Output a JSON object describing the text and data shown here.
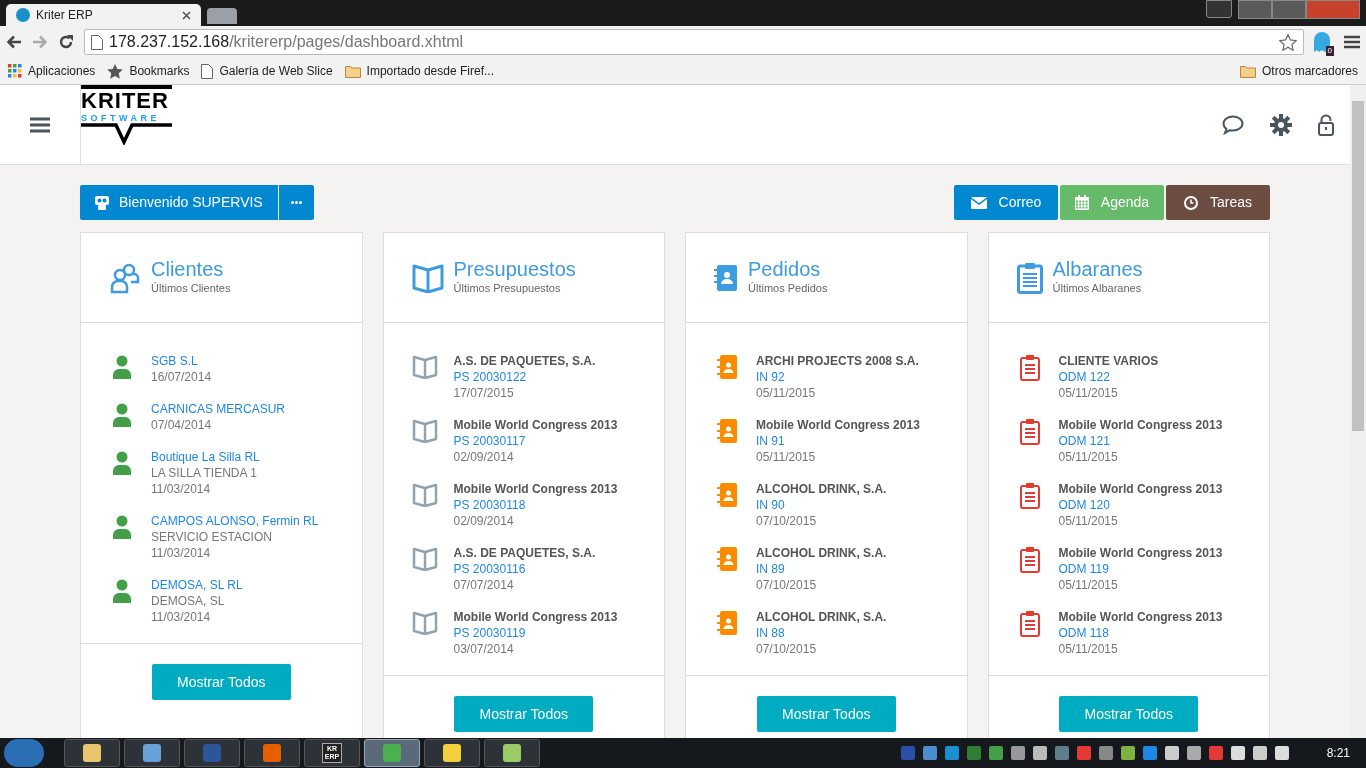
{
  "browser": {
    "tabs": [
      {
        "title": "Kriter ERP",
        "selected": true
      },
      {
        "selected": false
      }
    ],
    "url_host": "178.237.152.168",
    "url_path": "/kritererp/pages/dashboard.xhtml",
    "extension_badge": "0",
    "bookmarks": [
      {
        "kind": "apps",
        "label": "Aplicaciones"
      },
      {
        "kind": "star",
        "label": "Bookmarks"
      },
      {
        "kind": "page",
        "label": "Galería de Web Slice"
      },
      {
        "kind": "folder",
        "label": "Importado desde Firef..."
      }
    ],
    "other_bookmarks": "Otros marcadores"
  },
  "header": {
    "logo_top": "KRITER",
    "logo_bottom": "SOFTWARE"
  },
  "welcome_button": "Bienvenido SUPERVIS",
  "actions": [
    {
      "kind": "mail",
      "label": "Correo",
      "color": "#0288d1"
    },
    {
      "kind": "calendar",
      "label": "Agenda",
      "color": "#66bb6a"
    },
    {
      "kind": "clock",
      "label": "Tareas",
      "color": "#6d4c41"
    }
  ],
  "cards": [
    {
      "kind": "clients",
      "title": "Clientes",
      "subtitle": "Últimos Clientes",
      "button": "Mostrar Todos",
      "items": [
        {
          "name": "SGB S.L",
          "date": "16/07/2014"
        },
        {
          "name": "CARNICAS MERCASUR",
          "date": "07/04/2014"
        },
        {
          "name": "Boutique La Silla RL",
          "detail": "LA SILLA TIENDA 1",
          "date": "11/03/2014"
        },
        {
          "name": "CAMPOS ALONSO, Fermin RL",
          "detail": "SERVICIO ESTACION",
          "date": "11/03/2014"
        },
        {
          "name": "DEMOSA, SL RL",
          "detail": "DEMOSA, SL",
          "date": "11/03/2014"
        }
      ]
    },
    {
      "kind": "quotes",
      "title": "Presupuestos",
      "subtitle": "Últimos Presupuestos",
      "button": "Mostrar Todos",
      "items": [
        {
          "name": "A.S. DE PAQUETES, S.A.",
          "code": "PS 20030122",
          "date": "17/07/2015"
        },
        {
          "name": "Mobile World Congress 2013",
          "code": "PS 20030117",
          "date": "02/09/2014"
        },
        {
          "name": "Mobile World Congress 2013",
          "code": "PS 20030118",
          "date": "02/09/2014"
        },
        {
          "name": "A.S. DE PAQUETES, S.A.",
          "code": "PS 20030116",
          "date": "07/07/2014"
        },
        {
          "name": "Mobile World Congress 2013",
          "code": "PS 20030119",
          "date": "03/07/2014"
        }
      ]
    },
    {
      "kind": "orders",
      "title": "Pedidos",
      "subtitle": "Últimos Pedidos",
      "button": "Mostrar Todos",
      "items": [
        {
          "name": "ARCHI PROJECTS 2008 S.A.",
          "code": "IN 92",
          "date": "05/11/2015"
        },
        {
          "name": "Mobile World Congress 2013",
          "code": "IN 91",
          "date": "05/11/2015"
        },
        {
          "name": "ALCOHOL DRINK, S.A.",
          "code": "IN 90",
          "date": "07/10/2015"
        },
        {
          "name": "ALCOHOL DRINK, S.A.",
          "code": "IN 89",
          "date": "07/10/2015"
        },
        {
          "name": "ALCOHOL DRINK, S.A.",
          "code": "IN 88",
          "date": "07/10/2015"
        }
      ]
    },
    {
      "kind": "delivery",
      "title": "Albaranes",
      "subtitle": "Últimos Albaranes",
      "button": "Mostrar Todos",
      "items": [
        {
          "name": "CLIENTE VARIOS",
          "code": "ODM 122",
          "date": "05/11/2015"
        },
        {
          "name": "Mobile World Congress 2013",
          "code": "ODM 121",
          "date": "05/11/2015"
        },
        {
          "name": "Mobile World Congress 2013",
          "code": "ODM 120",
          "date": "05/11/2015"
        },
        {
          "name": "Mobile World Congress 2013",
          "code": "ODM 119",
          "date": "05/11/2015"
        },
        {
          "name": "Mobile World Congress 2013",
          "code": "ODM 118",
          "date": "05/11/2015"
        }
      ]
    }
  ],
  "taskbar": {
    "apps": [
      {
        "kind": "explorer",
        "selected": false
      },
      {
        "kind": "remote",
        "selected": false
      },
      {
        "kind": "word",
        "selected": false
      },
      {
        "kind": "firefox",
        "selected": false
      },
      {
        "kind": "erp",
        "label": "KR ERP",
        "selected": false
      },
      {
        "kind": "chrome",
        "selected": true
      },
      {
        "kind": "paint",
        "selected": false
      },
      {
        "kind": "chat",
        "selected": false
      }
    ],
    "clock": "8:21"
  }
}
